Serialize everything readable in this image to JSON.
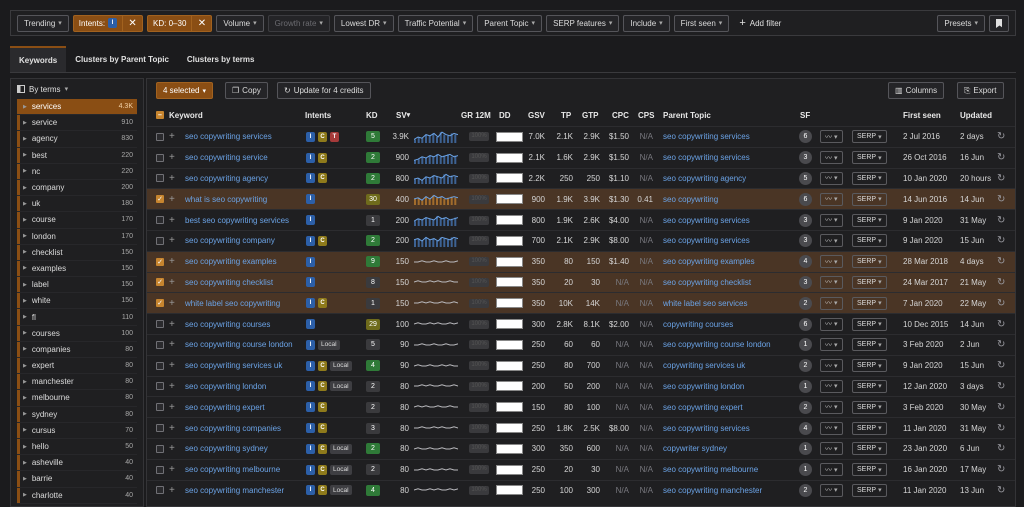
{
  "filters": {
    "trending": "Trending",
    "intents_label": "Intents:",
    "intents_badge": "I",
    "kd": "KD: 0–30",
    "volume": "Volume",
    "growth_rate": "Growth rate",
    "lowest_dr": "Lowest DR",
    "traffic_potential": "Traffic Potential",
    "parent_topic": "Parent Topic",
    "serp_features": "SERP features",
    "include": "Include",
    "first_seen": "First seen",
    "add_filter": "Add filter",
    "presets": "Presets"
  },
  "tabs": [
    "Keywords",
    "Clusters by Parent Topic",
    "Clusters by terms"
  ],
  "sidebar": {
    "header": "By terms",
    "items": [
      {
        "term": "services",
        "count": "4.3K"
      },
      {
        "term": "service",
        "count": "910"
      },
      {
        "term": "agency",
        "count": "830"
      },
      {
        "term": "best",
        "count": "220"
      },
      {
        "term": "nc",
        "count": "220"
      },
      {
        "term": "company",
        "count": "200"
      },
      {
        "term": "uk",
        "count": "180"
      },
      {
        "term": "course",
        "count": "170"
      },
      {
        "term": "london",
        "count": "170"
      },
      {
        "term": "checklist",
        "count": "150"
      },
      {
        "term": "examples",
        "count": "150"
      },
      {
        "term": "label",
        "count": "150"
      },
      {
        "term": "white",
        "count": "150"
      },
      {
        "term": "fl",
        "count": "110"
      },
      {
        "term": "courses",
        "count": "100"
      },
      {
        "term": "companies",
        "count": "80"
      },
      {
        "term": "expert",
        "count": "80"
      },
      {
        "term": "manchester",
        "count": "80"
      },
      {
        "term": "melbourne",
        "count": "80"
      },
      {
        "term": "sydney",
        "count": "80"
      },
      {
        "term": "cursus",
        "count": "70"
      },
      {
        "term": "hello",
        "count": "50"
      },
      {
        "term": "asheville",
        "count": "40"
      },
      {
        "term": "barrie",
        "count": "40"
      },
      {
        "term": "charlotte",
        "count": "40"
      }
    ]
  },
  "toolbar": {
    "selected": "4 selected",
    "copy": "Copy",
    "update": "Update for 4 credits",
    "columns": "Columns",
    "export": "Export"
  },
  "columns": {
    "keyword": "Keyword",
    "intents": "Intents",
    "kd": "KD",
    "sv": "SV",
    "gr": "GR 12M",
    "dd": "DD",
    "gsv": "GSV",
    "tp": "TP",
    "gtp": "GTP",
    "cpc": "CPC",
    "cps": "CPS",
    "parent": "Parent Topic",
    "sf": "SF",
    "first_seen": "First seen",
    "updated": "Updated"
  },
  "serp_label": "SERP",
  "local_label": "Local",
  "gr_placeholder": "100%",
  "rows": [
    {
      "kw": "seo copywriting services",
      "intents": [
        "I",
        "C",
        "T"
      ],
      "local": false,
      "kd": "5",
      "kdc": "g",
      "sv": "3.9K",
      "gsv": "7.0K",
      "tp": "2.1K",
      "gtp": "2.9K",
      "cpc": "$1.50",
      "cps": "N/A",
      "parent": "seo copywriting services",
      "sf": "6",
      "first": "2 Jul 2016",
      "upd": "2 days",
      "sel": false,
      "trend": [
        0.3,
        0.5,
        0.4,
        0.7,
        0.6,
        0.8,
        0.5,
        0.9,
        0.7,
        0.6,
        0.8,
        0.7
      ]
    },
    {
      "kw": "seo copywriting service",
      "intents": [
        "I",
        "C"
      ],
      "local": false,
      "kd": "2",
      "kdc": "g",
      "sv": "900",
      "gsv": "2.1K",
      "tp": "1.6K",
      "gtp": "2.9K",
      "cpc": "$1.50",
      "cps": "N/A",
      "parent": "seo copywriting services",
      "sf": "3",
      "first": "26 Oct 2016",
      "upd": "16 Jun",
      "sel": false,
      "trend": [
        0.3,
        0.4,
        0.6,
        0.5,
        0.7,
        0.6,
        0.8,
        0.6,
        0.7,
        0.8,
        0.6,
        0.7
      ]
    },
    {
      "kw": "seo copywriting agency",
      "intents": [
        "I",
        "C"
      ],
      "local": false,
      "kd": "2",
      "kdc": "g",
      "sv": "800",
      "gsv": "2.2K",
      "tp": "250",
      "gtp": "250",
      "cpc": "$1.10",
      "cps": "N/A",
      "parent": "seo copywriting agency",
      "sf": "5",
      "first": "10 Jan 2020",
      "upd": "20 hours",
      "sel": false,
      "trend": [
        0.4,
        0.5,
        0.3,
        0.6,
        0.5,
        0.7,
        0.6,
        0.5,
        0.8,
        0.6,
        0.7,
        0.6
      ]
    },
    {
      "kw": "what is seo copywriting",
      "intents": [
        "I"
      ],
      "local": false,
      "kd": "30",
      "kdc": "y",
      "sv": "400",
      "gsv": "900",
      "tp": "1.9K",
      "gtp": "3.9K",
      "cpc": "$1.30",
      "cps": "0.41",
      "parent": "seo copywriting",
      "sf": "6",
      "first": "14 Jun 2016",
      "upd": "14 Jun",
      "sel": true,
      "trend": [
        0.5,
        0.6,
        0.4,
        0.7,
        0.5,
        0.8,
        0.6,
        0.7,
        0.5,
        0.6,
        0.7,
        0.6
      ]
    },
    {
      "kw": "best seo copywriting services",
      "intents": [
        "I"
      ],
      "local": false,
      "kd": "1",
      "kdc": "k",
      "sv": "200",
      "gsv": "800",
      "tp": "1.9K",
      "gtp": "2.6K",
      "cpc": "$4.00",
      "cps": "N/A",
      "parent": "seo copywriting services",
      "sf": "3",
      "first": "9 Jan 2020",
      "upd": "31 May",
      "sel": false,
      "trend": [
        0.4,
        0.6,
        0.5,
        0.7,
        0.6,
        0.5,
        0.8,
        0.6,
        0.7,
        0.5,
        0.6,
        0.7
      ]
    },
    {
      "kw": "seo copywriting company",
      "intents": [
        "I",
        "C"
      ],
      "local": false,
      "kd": "2",
      "kdc": "g",
      "sv": "200",
      "gsv": "700",
      "tp": "2.1K",
      "gtp": "2.9K",
      "cpc": "$8.00",
      "cps": "N/A",
      "parent": "seo copywriting services",
      "sf": "3",
      "first": "9 Jan 2020",
      "upd": "15 Jun",
      "sel": false,
      "trend": [
        0.6,
        0.7,
        0.5,
        0.8,
        0.6,
        0.7,
        0.5,
        0.8,
        0.7,
        0.6,
        0.8,
        0.7
      ]
    },
    {
      "kw": "seo copywriting examples",
      "intents": [
        "I"
      ],
      "local": false,
      "kd": "9",
      "kdc": "g",
      "sv": "150",
      "gsv": "350",
      "tp": "80",
      "gtp": "150",
      "cpc": "$1.40",
      "cps": "N/A",
      "parent": "seo copywriting examples",
      "sf": "4",
      "first": "28 Mar 2018",
      "upd": "4 days",
      "sel": true,
      "trend": [
        0.5,
        0.5,
        0.6,
        0.5,
        0.5,
        0.6,
        0.5,
        0.5,
        0.6,
        0.5,
        0.5,
        0.6
      ]
    },
    {
      "kw": "seo copywriting checklist",
      "intents": [
        "I"
      ],
      "local": false,
      "kd": "8",
      "kdc": "k",
      "sv": "150",
      "gsv": "350",
      "tp": "20",
      "gtp": "30",
      "cpc": "N/A",
      "cps": "N/A",
      "parent": "seo copywriting checklist",
      "sf": "3",
      "first": "24 Mar 2017",
      "upd": "21 May",
      "sel": true,
      "trend": [
        0.5,
        0.6,
        0.5,
        0.5,
        0.6,
        0.5,
        0.6,
        0.5,
        0.5,
        0.6,
        0.5,
        0.5
      ]
    },
    {
      "kw": "white label seo copywriting",
      "intents": [
        "I",
        "C"
      ],
      "local": false,
      "kd": "1",
      "kdc": "k",
      "sv": "150",
      "gsv": "350",
      "tp": "10K",
      "gtp": "14K",
      "cpc": "N/A",
      "cps": "N/A",
      "parent": "white label seo services",
      "sf": "2",
      "first": "7 Jan 2020",
      "upd": "22 May",
      "sel": true,
      "trend": [
        0.5,
        0.5,
        0.6,
        0.5,
        0.6,
        0.5,
        0.5,
        0.6,
        0.5,
        0.5,
        0.6,
        0.5
      ]
    },
    {
      "kw": "seo copywriting courses",
      "intents": [
        "I"
      ],
      "local": false,
      "kd": "29",
      "kdc": "y",
      "sv": "100",
      "gsv": "300",
      "tp": "2.8K",
      "gtp": "8.1K",
      "cpc": "$2.00",
      "cps": "N/A",
      "parent": "copywriting courses",
      "sf": "6",
      "first": "10 Dec 2015",
      "upd": "14 Jun",
      "sel": false,
      "trend": [
        0.5,
        0.6,
        0.5,
        0.5,
        0.6,
        0.5,
        0.6,
        0.5,
        0.5,
        0.6,
        0.5,
        0.6
      ]
    },
    {
      "kw": "seo copywriting course london",
      "intents": [
        "I"
      ],
      "local": true,
      "kd": "5",
      "kdc": "k",
      "sv": "90",
      "gsv": "250",
      "tp": "60",
      "gtp": "60",
      "cpc": "N/A",
      "cps": "N/A",
      "parent": "seo copywriting course london",
      "sf": "1",
      "first": "3 Feb 2020",
      "upd": "2 Jun",
      "sel": false,
      "trend": [
        0.5,
        0.5,
        0.6,
        0.5,
        0.5,
        0.6,
        0.5,
        0.5,
        0.6,
        0.5,
        0.5,
        0.6
      ]
    },
    {
      "kw": "seo copywriting services uk",
      "intents": [
        "I",
        "C"
      ],
      "local": true,
      "kd": "4",
      "kdc": "g",
      "sv": "90",
      "gsv": "250",
      "tp": "80",
      "gtp": "700",
      "cpc": "N/A",
      "cps": "N/A",
      "parent": "copywriting services uk",
      "sf": "2",
      "first": "9 Jan 2020",
      "upd": "15 Jun",
      "sel": false,
      "trend": [
        0.5,
        0.6,
        0.5,
        0.5,
        0.6,
        0.5,
        0.5,
        0.6,
        0.5,
        0.6,
        0.5,
        0.5
      ]
    },
    {
      "kw": "seo copywriting london",
      "intents": [
        "I",
        "C"
      ],
      "local": true,
      "kd": "2",
      "kdc": "k",
      "sv": "80",
      "gsv": "200",
      "tp": "50",
      "gtp": "200",
      "cpc": "N/A",
      "cps": "N/A",
      "parent": "seo copywriting london",
      "sf": "1",
      "first": "12 Jan 2020",
      "upd": "3 days",
      "sel": false,
      "trend": [
        0.5,
        0.5,
        0.6,
        0.5,
        0.6,
        0.5,
        0.5,
        0.6,
        0.5,
        0.5,
        0.6,
        0.5
      ]
    },
    {
      "kw": "seo copywriting expert",
      "intents": [
        "I",
        "C"
      ],
      "local": false,
      "kd": "2",
      "kdc": "k",
      "sv": "80",
      "gsv": "150",
      "tp": "80",
      "gtp": "100",
      "cpc": "N/A",
      "cps": "N/A",
      "parent": "seo copywriting expert",
      "sf": "2",
      "first": "3 Feb 2020",
      "upd": "30 May",
      "sel": false,
      "trend": [
        0.5,
        0.6,
        0.5,
        0.6,
        0.5,
        0.5,
        0.6,
        0.5,
        0.5,
        0.6,
        0.5,
        0.5
      ]
    },
    {
      "kw": "seo copywriting companies",
      "intents": [
        "I",
        "C"
      ],
      "local": false,
      "kd": "3",
      "kdc": "k",
      "sv": "80",
      "gsv": "250",
      "tp": "1.8K",
      "gtp": "2.5K",
      "cpc": "$8.00",
      "cps": "N/A",
      "parent": "seo copywriting services",
      "sf": "4",
      "first": "11 Jan 2020",
      "upd": "31 May",
      "sel": false,
      "trend": [
        0.5,
        0.5,
        0.6,
        0.5,
        0.5,
        0.6,
        0.5,
        0.6,
        0.5,
        0.5,
        0.6,
        0.5
      ]
    },
    {
      "kw": "seo copywriting sydney",
      "intents": [
        "I",
        "C"
      ],
      "local": true,
      "kd": "2",
      "kdc": "g",
      "sv": "80",
      "gsv": "300",
      "tp": "350",
      "gtp": "600",
      "cpc": "N/A",
      "cps": "N/A",
      "parent": "copywriter sydney",
      "sf": "1",
      "first": "23 Jan 2020",
      "upd": "6 Jun",
      "sel": false,
      "trend": [
        0.5,
        0.6,
        0.5,
        0.5,
        0.6,
        0.5,
        0.5,
        0.6,
        0.5,
        0.5,
        0.6,
        0.5
      ]
    },
    {
      "kw": "seo copywriting melbourne",
      "intents": [
        "I",
        "C"
      ],
      "local": true,
      "kd": "2",
      "kdc": "k",
      "sv": "80",
      "gsv": "250",
      "tp": "20",
      "gtp": "30",
      "cpc": "N/A",
      "cps": "N/A",
      "parent": "seo copywriting melbourne",
      "sf": "1",
      "first": "16 Jan 2020",
      "upd": "17 May",
      "sel": false,
      "trend": [
        0.5,
        0.5,
        0.6,
        0.5,
        0.6,
        0.5,
        0.5,
        0.6,
        0.5,
        0.6,
        0.5,
        0.5
      ]
    },
    {
      "kw": "seo copywriting manchester",
      "intents": [
        "I",
        "C"
      ],
      "local": true,
      "kd": "4",
      "kdc": "g",
      "sv": "80",
      "gsv": "250",
      "tp": "100",
      "gtp": "300",
      "cpc": "N/A",
      "cps": "N/A",
      "parent": "seo copywriting manchester",
      "sf": "2",
      "first": "11 Jan 2020",
      "upd": "13 Jun",
      "sel": false,
      "trend": [
        0.5,
        0.6,
        0.5,
        0.5,
        0.6,
        0.5,
        0.6,
        0.5,
        0.5,
        0.6,
        0.5,
        0.6
      ]
    }
  ]
}
